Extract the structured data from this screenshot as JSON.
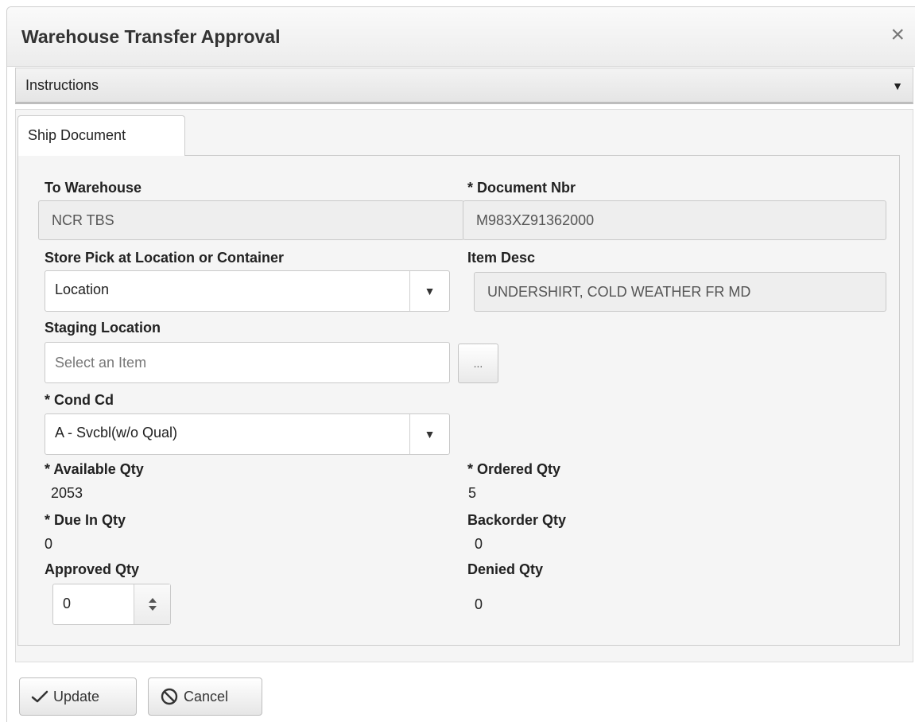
{
  "dialog": {
    "title": "Warehouse Transfer Approval",
    "close_glyph": "×",
    "close_icon": "close-icon"
  },
  "instructions": {
    "label": "Instructions",
    "toggle_glyph": "▼"
  },
  "tabs": [
    {
      "label": "Ship Document",
      "active": true
    }
  ],
  "form": {
    "to_warehouse": {
      "label": "To Warehouse",
      "value": "NCR TBS"
    },
    "document_nbr": {
      "label": "* Document Nbr",
      "value": "M983XZ91362000"
    },
    "store_pick": {
      "label": "Store Pick at Location or Container",
      "selected": "Location"
    },
    "item_desc": {
      "label": "Item Desc",
      "value": "UNDERSHIRT, COLD WEATHER FR MD"
    },
    "staging_location": {
      "label": "Staging Location",
      "placeholder": "Select an Item",
      "lookup_label": "..."
    },
    "cond_cd": {
      "label": "* Cond Cd",
      "selected": "A - Svcbl(w/o Qual)"
    },
    "available_qty": {
      "label": "* Available Qty",
      "value": "2053"
    },
    "ordered_qty": {
      "label": "* Ordered Qty",
      "value": "5"
    },
    "due_in_qty": {
      "label": "* Due In Qty",
      "value": "0"
    },
    "backorder_qty": {
      "label": "Backorder Qty",
      "value": "0"
    },
    "approved_qty": {
      "label": "Approved Qty",
      "value": "0"
    },
    "denied_qty": {
      "label": "Denied Qty",
      "value": "0"
    }
  },
  "dropdown_glyph": "▼",
  "actions": {
    "update_label": "Update",
    "cancel_label": "Cancel"
  },
  "colors": {
    "panel_bg": "#f5f5f5",
    "readonly_field_bg": "#eeeeee",
    "border": "#c9c9c9"
  }
}
